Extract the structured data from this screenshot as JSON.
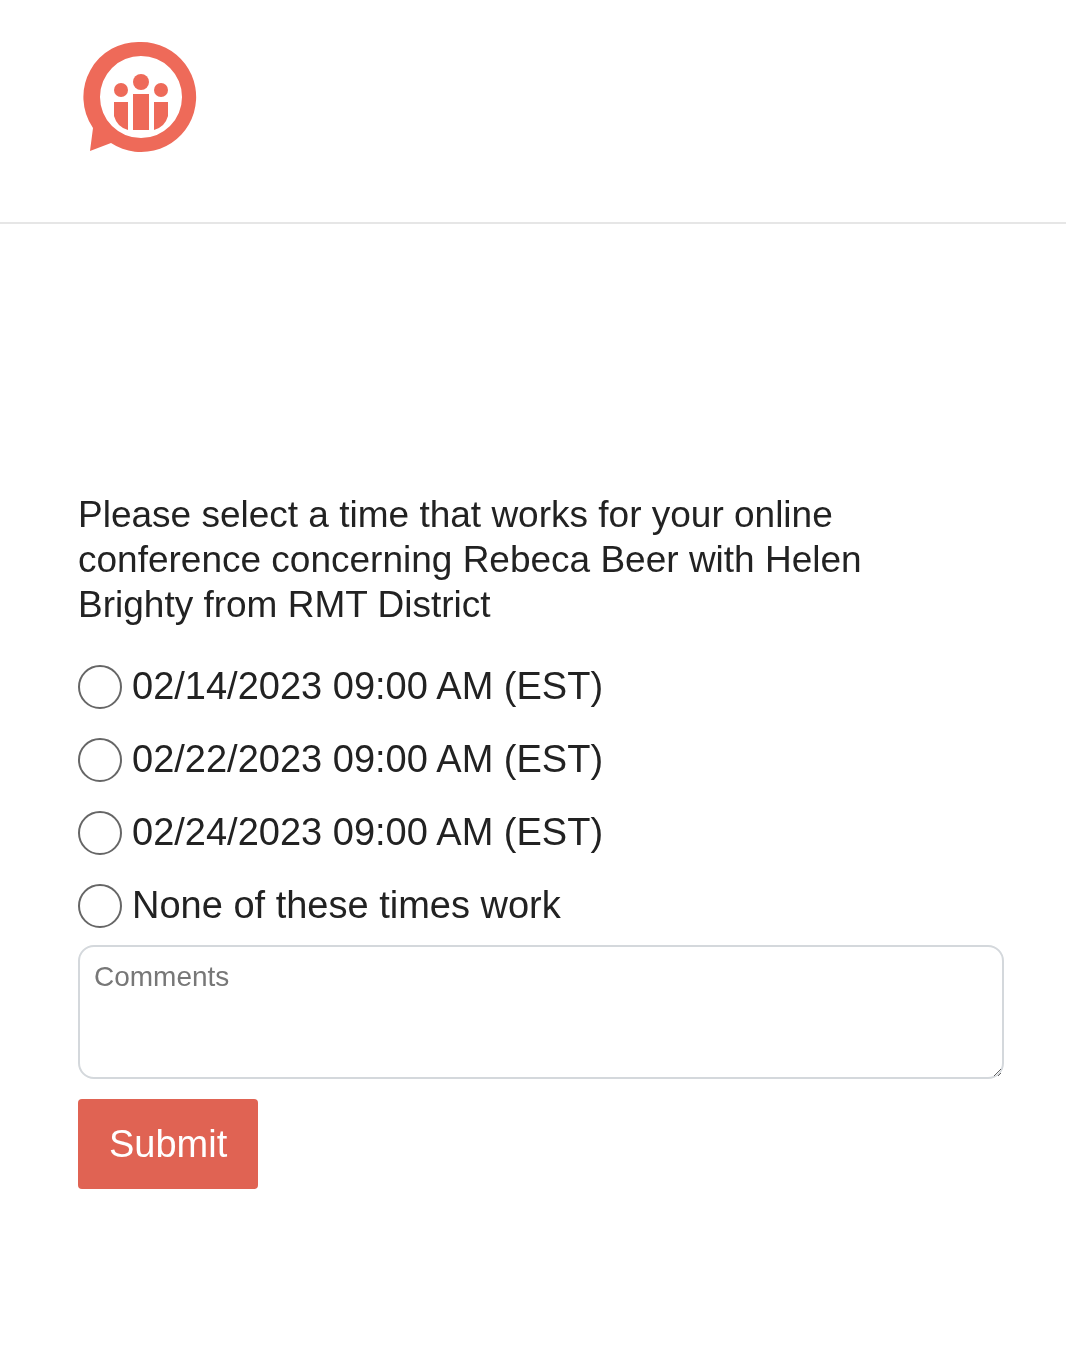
{
  "prompt": "Please select a time that works for your online conference concerning Rebeca Beer with Helen Brighty from RMT District",
  "options": [
    {
      "label": "02/14/2023 09:00 AM (EST)",
      "selected": false
    },
    {
      "label": "02/22/2023 09:00 AM (EST)",
      "selected": false
    },
    {
      "label": "02/24/2023 09:00 AM (EST)",
      "selected": false
    },
    {
      "label": "None of these times work",
      "selected": false
    }
  ],
  "comments": {
    "placeholder": "Comments"
  },
  "submit": "Submit"
}
